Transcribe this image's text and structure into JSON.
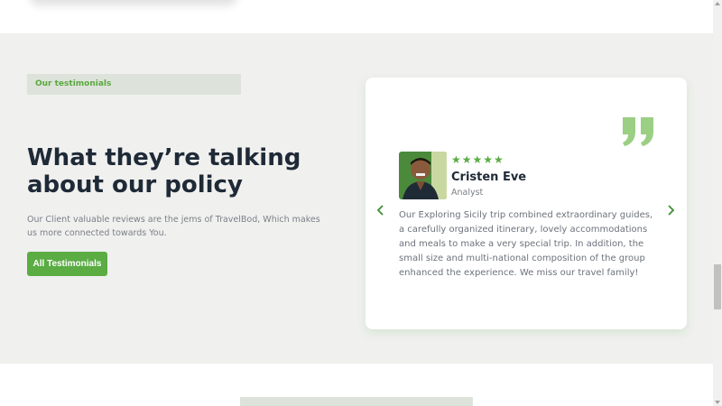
{
  "testimonials": {
    "badge": "Our testimonials",
    "heading": "What they’re talking about our policy",
    "description": "Our Client valuable reviews are the jems of TravelBod, Which makes us more connected towards You.",
    "button_label": "All Testimonials"
  },
  "review_card": {
    "stars": "★★★★★",
    "rating": 5,
    "name": "Cristen Eve",
    "role": "Analyst",
    "text": "Our Exploring Sicily trip combined extraordinary guides, a carefully organized itinerary, lovely accommodations and meals to make a very special trip. In addition, the small size and multi-national composition of the group enhanced the experience. We miss our travel family!",
    "icons": [
      "quote-icon",
      "chevron-left-icon",
      "chevron-right-icon",
      "avatar"
    ]
  },
  "colors": {
    "accent": "#5aac43",
    "badge_bg": "#dde3da",
    "section_bg": "#f0f0ef",
    "heading": "#1f2a37"
  }
}
